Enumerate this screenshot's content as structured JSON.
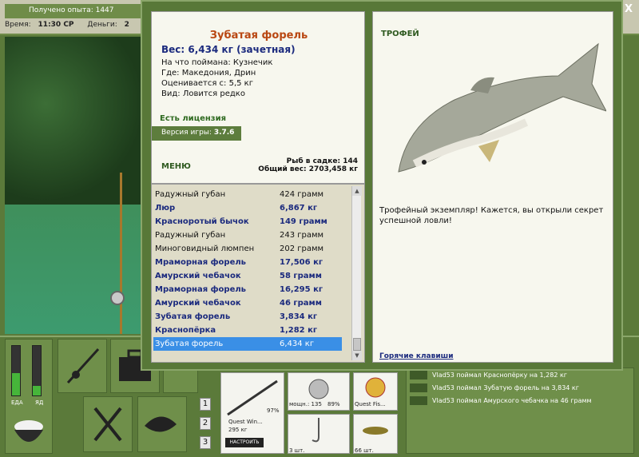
{
  "status": {
    "experience": "Получено опыта: 1447",
    "time_label": "Время:",
    "time_value": "11:30 СР",
    "money_label": "Деньги:",
    "money_value": "2"
  },
  "close_label": "X",
  "fish": {
    "title": "Зубатая форель",
    "weight": "Вес: 6,434 кг (зачетная)",
    "caught_with": "На что поймана: Кузнечик",
    "location": "Где: Македония, Дрин",
    "valued_from": "Оценивается с: 5,5 кг",
    "rarity": "Вид: Ловится редко"
  },
  "license": "Есть лицензия",
  "version": {
    "label": "Версия игры:",
    "value": "3.7.6"
  },
  "menu_label": "МЕНЮ",
  "totals": {
    "fish_in_net": "Рыб в садке: 144",
    "total_weight": "Общий вес: 2703,458 кг"
  },
  "catch_list": [
    {
      "name": "Радужный губан",
      "weight": "424 грамм",
      "bold": false
    },
    {
      "name": "Люр",
      "weight": "6,867 кг",
      "bold": true
    },
    {
      "name": "Красноротый бычок",
      "weight": "149 грамм",
      "bold": true
    },
    {
      "name": "Радужный губан",
      "weight": "243 грамм",
      "bold": false
    },
    {
      "name": "Миноговидный люмпен",
      "weight": "202 грамм",
      "bold": false
    },
    {
      "name": "Мраморная форель",
      "weight": "17,506 кг",
      "bold": true
    },
    {
      "name": "Амурский чебачок",
      "weight": "58 грамм",
      "bold": true
    },
    {
      "name": "Мраморная форель",
      "weight": "16,295 кг",
      "bold": true
    },
    {
      "name": "Амурский чебачок",
      "weight": "46 грамм",
      "bold": true
    },
    {
      "name": "Зубатая форель",
      "weight": "3,834 кг",
      "bold": true
    },
    {
      "name": "Краснопёрка",
      "weight": "1,282 кг",
      "bold": true
    },
    {
      "name": "Зубатая форель",
      "weight": "6,434 кг",
      "bold": false,
      "selected": true
    }
  ],
  "trophy": {
    "title": "ТРОФЕЙ",
    "text": "Трофейный экземпляр! Кажется, вы открыли секрет успешной ловли!",
    "hotkeys": "Горячие клавиши"
  },
  "meters": {
    "eat_label": "ЕДА",
    "sleep_label": "ЯД",
    "eat_level": 0.45,
    "sleep_level": 0.2
  },
  "tabs": [
    "1",
    "2",
    "3"
  ],
  "inventory": {
    "rod_name": "Quest Win...",
    "rod_weight": "295 кг",
    "rod_percent": "97%",
    "setup_label": "НАСТРОИТЬ",
    "reel_info": "мощн.: 135",
    "reel_percent": "89%",
    "line_name": "Quest Fis...",
    "hooks_count": "3 шт.",
    "bait_count": "66 шт."
  },
  "log": [
    "Vlad53 поймал Краснопёрку на 1,282 кг",
    "Vlad53 поймал Зубатую форель на 3,834 кг",
    "Vlad53 поймал Амурского чебачка на 46 грамм"
  ]
}
